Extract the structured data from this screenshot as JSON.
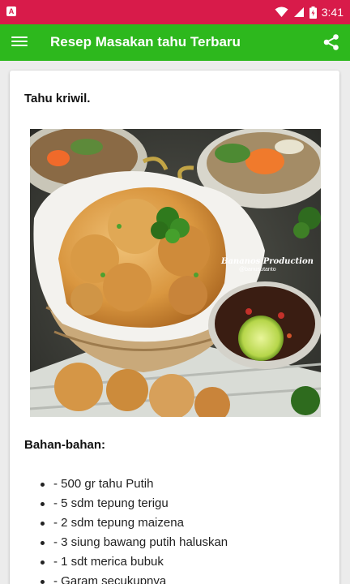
{
  "status_bar": {
    "time": "3:41",
    "app_badge": "A",
    "icons": [
      "wifi-icon",
      "signal-icon",
      "battery-icon"
    ]
  },
  "app_bar": {
    "title": "Resep Masakan tahu Terbaru",
    "menu_icon": "menu-icon",
    "share_icon": "share-icon"
  },
  "recipe": {
    "title": "Tahu kriwil.",
    "photo_watermark": "Bananos Production",
    "photo_watermark_sub": "@banusutanto",
    "ingredients_heading": "Bahan-bahan:",
    "ingredients": [
      "- 500 gr tahu Putih",
      "- 5 sdm tepung terigu",
      "- 2 sdm tepung maizena",
      "- 3 siung bawang putih haluskan",
      "- 1 sdt merica bubuk",
      "- Garam secukupnya"
    ]
  },
  "colors": {
    "status_bar": "#d81b4a",
    "app_bar": "#2db81d",
    "background": "#ececec"
  }
}
